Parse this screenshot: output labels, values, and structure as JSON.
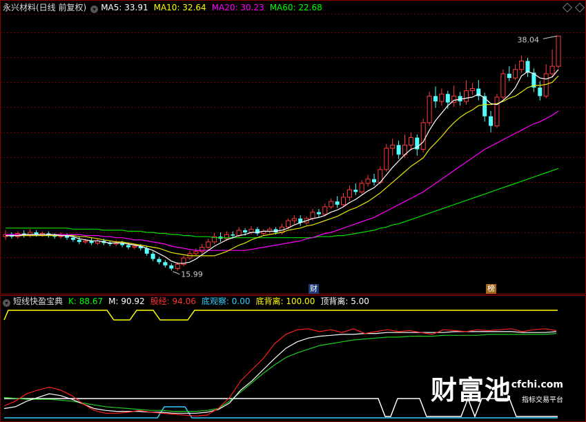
{
  "stock_title": "永兴材料(日线 前复权)",
  "ma_legend": [
    {
      "label": "MA5: 33.91",
      "color": "#ffffff"
    },
    {
      "label": "MA10: 32.64",
      "color": "#ffff00"
    },
    {
      "label": "MA20: 30.23",
      "color": "#ff00ff"
    },
    {
      "label": "MA60: 22.68",
      "color": "#00ff00"
    }
  ],
  "high_label": "38.04",
  "low_label": "15.99",
  "tags": {
    "cai": "财",
    "bang": "榜"
  },
  "indicator": {
    "name": "短线快盈宝典",
    "items": [
      {
        "label": "K: 88.67",
        "color": "#00ff00"
      },
      {
        "label": "M: 90.92",
        "color": "#ffffff"
      },
      {
        "label": "股经: 94.06",
        "color": "#ff3333"
      },
      {
        "label": "底观察: 0.00",
        "color": "#33ccff"
      },
      {
        "label": "底背离: 100.00",
        "color": "#ffff00"
      },
      {
        "label": "顶背离: 5.00",
        "color": "#ffffff"
      }
    ]
  },
  "watermark": {
    "main": "财富池",
    "url": "cfchi.com",
    "sub": "指标交易平台"
  },
  "chart_data": {
    "type": "candlestick",
    "ylim": [
      15,
      40
    ],
    "candles": [
      [
        19.2,
        19.4,
        18.9,
        19.8
      ],
      [
        19.4,
        19.2,
        19.0,
        19.6
      ],
      [
        19.2,
        19.5,
        19.0,
        19.7
      ],
      [
        19.5,
        19.3,
        19.1,
        19.8
      ],
      [
        19.3,
        19.6,
        19.1,
        19.9
      ],
      [
        19.6,
        19.4,
        19.2,
        19.8
      ],
      [
        19.4,
        19.5,
        19.2,
        19.7
      ],
      [
        19.5,
        19.3,
        19.1,
        19.7
      ],
      [
        19.3,
        19.2,
        19.0,
        19.5
      ],
      [
        19.2,
        19.3,
        19.0,
        19.6
      ],
      [
        19.3,
        19.1,
        18.9,
        19.5
      ],
      [
        19.1,
        18.9,
        18.7,
        19.3
      ],
      [
        18.9,
        18.7,
        18.5,
        19.2
      ],
      [
        18.7,
        18.8,
        18.5,
        19.0
      ],
      [
        18.8,
        18.6,
        18.4,
        19.1
      ],
      [
        18.6,
        18.8,
        18.4,
        19.0
      ],
      [
        18.8,
        18.6,
        18.4,
        19.0
      ],
      [
        18.6,
        18.5,
        18.3,
        18.8
      ],
      [
        18.5,
        18.6,
        18.3,
        18.9
      ],
      [
        18.6,
        18.4,
        18.2,
        18.8
      ],
      [
        18.4,
        18.2,
        18.0,
        18.6
      ],
      [
        18.2,
        18.3,
        18.0,
        18.5
      ],
      [
        18.3,
        18.1,
        17.9,
        18.5
      ],
      [
        18.1,
        17.6,
        17.4,
        18.3
      ],
      [
        17.6,
        17.1,
        16.9,
        17.8
      ],
      [
        17.1,
        16.8,
        16.6,
        17.3
      ],
      [
        16.8,
        16.5,
        16.3,
        17.0
      ],
      [
        16.5,
        16.2,
        15.99,
        16.7
      ],
      [
        16.2,
        16.6,
        16.0,
        16.8
      ],
      [
        16.6,
        17.2,
        16.4,
        17.4
      ],
      [
        17.2,
        17.6,
        17.0,
        17.9
      ],
      [
        17.6,
        17.8,
        17.4,
        18.1
      ],
      [
        17.8,
        18.2,
        17.6,
        18.5
      ],
      [
        18.2,
        18.7,
        18.0,
        19.0
      ],
      [
        18.7,
        19.2,
        18.5,
        19.5
      ],
      [
        19.2,
        19.0,
        18.7,
        19.6
      ],
      [
        19.0,
        19.4,
        18.8,
        19.7
      ],
      [
        19.4,
        19.3,
        19.0,
        19.7
      ],
      [
        19.3,
        19.8,
        19.1,
        20.1
      ],
      [
        19.8,
        19.6,
        19.3,
        20.0
      ],
      [
        19.6,
        19.9,
        19.4,
        20.2
      ],
      [
        19.9,
        19.5,
        19.3,
        20.1
      ],
      [
        19.5,
        19.7,
        19.3,
        19.9
      ],
      [
        19.7,
        19.9,
        19.5,
        20.1
      ],
      [
        19.9,
        19.6,
        19.4,
        20.1
      ],
      [
        19.6,
        20.1,
        19.4,
        20.4
      ],
      [
        20.1,
        20.7,
        19.9,
        20.9
      ],
      [
        20.7,
        20.9,
        20.4,
        21.2
      ],
      [
        20.9,
        20.5,
        20.2,
        21.2
      ],
      [
        20.5,
        20.9,
        20.3,
        21.1
      ],
      [
        20.9,
        21.5,
        20.7,
        21.8
      ],
      [
        21.5,
        21.3,
        21.0,
        21.8
      ],
      [
        21.3,
        22.0,
        21.1,
        22.3
      ],
      [
        22.0,
        22.5,
        21.8,
        22.8
      ],
      [
        22.5,
        22.2,
        21.9,
        23.0
      ],
      [
        22.2,
        22.9,
        22.0,
        23.3
      ],
      [
        22.9,
        23.6,
        22.6,
        24.0
      ],
      [
        23.6,
        23.4,
        23.1,
        24.2
      ],
      [
        23.4,
        24.2,
        23.2,
        24.5
      ],
      [
        24.2,
        24.6,
        23.9,
        25.0
      ],
      [
        24.6,
        24.3,
        24.0,
        25.1
      ],
      [
        24.3,
        25.5,
        24.1,
        25.8
      ],
      [
        25.5,
        27.5,
        25.3,
        27.9
      ],
      [
        27.5,
        27.8,
        26.8,
        28.4
      ],
      [
        27.8,
        26.9,
        26.5,
        28.2
      ],
      [
        26.9,
        27.8,
        26.6,
        28.8
      ],
      [
        27.8,
        28.5,
        27.3,
        29.0
      ],
      [
        28.5,
        27.4,
        26.8,
        28.8
      ],
      [
        27.4,
        29.9,
        27.1,
        30.3
      ],
      [
        29.9,
        32.4,
        29.6,
        32.8
      ],
      [
        32.4,
        31.9,
        31.3,
        33.3
      ],
      [
        31.9,
        32.6,
        31.5,
        33.1
      ],
      [
        32.6,
        31.8,
        31.2,
        32.9
      ],
      [
        31.8,
        32.4,
        31.4,
        33.4
      ],
      [
        32.4,
        31.9,
        31.5,
        32.8
      ],
      [
        31.9,
        32.9,
        31.6,
        33.9
      ],
      [
        32.9,
        33.1,
        32.5,
        33.6
      ],
      [
        33.1,
        32.4,
        32.0,
        33.9
      ],
      [
        32.4,
        30.5,
        30.0,
        32.7
      ],
      [
        30.5,
        29.6,
        29.0,
        31.0
      ],
      [
        29.6,
        32.3,
        29.4,
        32.6
      ],
      [
        32.3,
        34.5,
        32.1,
        34.9
      ],
      [
        34.5,
        34.1,
        33.8,
        35.2
      ],
      [
        34.1,
        34.9,
        33.9,
        35.4
      ],
      [
        34.9,
        35.7,
        34.6,
        36.2
      ],
      [
        35.7,
        34.6,
        34.2,
        36.0
      ],
      [
        34.6,
        33.2,
        32.8,
        35.0
      ],
      [
        33.2,
        32.4,
        32.0,
        33.8
      ],
      [
        32.4,
        34.5,
        32.2,
        35.4
      ],
      [
        34.5,
        35.2,
        34.2,
        36.8
      ],
      [
        35.2,
        38.04,
        35.0,
        38.04
      ]
    ],
    "ma5": [
      19.3,
      19.3,
      19.3,
      19.4,
      19.4,
      19.4,
      19.4,
      19.4,
      19.4,
      19.3,
      19.3,
      19.2,
      19.0,
      18.9,
      18.8,
      18.8,
      18.7,
      18.6,
      18.6,
      18.6,
      18.5,
      18.4,
      18.3,
      18.1,
      17.9,
      17.6,
      17.3,
      16.9,
      16.7,
      16.7,
      16.8,
      17.1,
      17.5,
      17.9,
      18.3,
      18.6,
      18.9,
      19.1,
      19.3,
      19.4,
      19.6,
      19.6,
      19.7,
      19.7,
      19.7,
      19.8,
      20.0,
      20.3,
      20.5,
      20.7,
      20.9,
      21.0,
      21.2,
      21.5,
      21.7,
      22.0,
      22.4,
      22.7,
      23.1,
      23.5,
      23.8,
      24.3,
      25.0,
      25.7,
      26.3,
      26.9,
      27.4,
      27.6,
      28.1,
      29.2,
      30.1,
      30.8,
      31.5,
      32.0,
      32.1,
      32.2,
      32.3,
      32.6,
      32.2,
      31.7,
      31.6,
      32.0,
      32.5,
      33.2,
      34.3,
      34.7,
      34.5,
      34.1,
      34.0,
      34.2,
      34.9
    ],
    "ma10": [
      19.3,
      19.3,
      19.3,
      19.3,
      19.3,
      19.3,
      19.3,
      19.3,
      19.3,
      19.3,
      19.3,
      19.3,
      19.2,
      19.2,
      19.1,
      19.0,
      18.9,
      18.8,
      18.7,
      18.7,
      18.6,
      18.5,
      18.4,
      18.3,
      18.2,
      18.1,
      17.9,
      17.7,
      17.6,
      17.5,
      17.4,
      17.4,
      17.4,
      17.4,
      17.4,
      17.6,
      17.8,
      18.1,
      18.4,
      18.6,
      18.9,
      19.1,
      19.3,
      19.4,
      19.5,
      19.6,
      19.8,
      19.9,
      20.0,
      20.2,
      20.3,
      20.5,
      20.7,
      20.9,
      21.1,
      21.4,
      21.7,
      21.9,
      22.2,
      22.5,
      22.9,
      23.3,
      23.8,
      24.3,
      24.8,
      25.3,
      25.8,
      26.2,
      26.6,
      27.4,
      28.0,
      28.6,
      29.3,
      29.9,
      30.4,
      30.8,
      31.1,
      31.5,
      31.6,
      31.6,
      31.7,
      31.9,
      32.2,
      32.4,
      32.8,
      33.2,
      33.4,
      33.4,
      33.5,
      33.7,
      34.3
    ],
    "ma20": [
      19.4,
      19.4,
      19.4,
      19.4,
      19.4,
      19.4,
      19.4,
      19.4,
      19.4,
      19.4,
      19.4,
      19.4,
      19.4,
      19.3,
      19.3,
      19.3,
      19.2,
      19.2,
      19.1,
      19.1,
      19.0,
      18.9,
      18.9,
      18.8,
      18.7,
      18.6,
      18.5,
      18.3,
      18.2,
      18.1,
      18.0,
      17.9,
      17.9,
      17.9,
      17.9,
      17.9,
      17.9,
      17.9,
      17.9,
      17.9,
      18.0,
      18.1,
      18.2,
      18.3,
      18.4,
      18.5,
      18.6,
      18.7,
      18.8,
      19.0,
      19.1,
      19.3,
      19.5,
      19.6,
      19.8,
      20.0,
      20.2,
      20.4,
      20.6,
      20.8,
      21.0,
      21.3,
      21.6,
      21.9,
      22.2,
      22.5,
      22.8,
      23.1,
      23.4,
      23.8,
      24.2,
      24.6,
      25.0,
      25.4,
      25.8,
      26.2,
      26.6,
      27.0,
      27.4,
      27.7,
      28.0,
      28.3,
      28.6,
      28.9,
      29.2,
      29.5,
      29.8,
      30.0,
      30.3,
      30.6,
      31.0
    ],
    "ma60": [
      20.0,
      20.0,
      20.0,
      20.0,
      20.0,
      20.0,
      20.0,
      20.0,
      20.0,
      20.0,
      20.0,
      19.9,
      19.9,
      19.9,
      19.9,
      19.9,
      19.8,
      19.8,
      19.8,
      19.8,
      19.7,
      19.7,
      19.7,
      19.6,
      19.6,
      19.5,
      19.5,
      19.4,
      19.4,
      19.3,
      19.3,
      19.2,
      19.2,
      19.2,
      19.1,
      19.1,
      19.1,
      19.1,
      19.1,
      19.1,
      19.1,
      19.1,
      19.1,
      19.1,
      19.1,
      19.1,
      19.1,
      19.1,
      19.1,
      19.1,
      19.1,
      19.2,
      19.2,
      19.2,
      19.3,
      19.3,
      19.4,
      19.5,
      19.6,
      19.7,
      19.8,
      20.0,
      20.1,
      20.3,
      20.4,
      20.6,
      20.8,
      21.0,
      21.2,
      21.4,
      21.6,
      21.8,
      22.0,
      22.2,
      22.4,
      22.6,
      22.8,
      23.0,
      23.2,
      23.4,
      23.6,
      23.8,
      24.0,
      24.2,
      24.4,
      24.6,
      24.8,
      25.0,
      25.2,
      25.4,
      25.6
    ],
    "ind": {
      "ylim": [
        0,
        110
      ],
      "red": [
        13,
        18,
        26,
        30,
        33,
        30,
        24,
        15,
        8,
        5,
        5,
        6,
        8,
        6,
        5,
        4,
        3,
        2,
        3,
        10,
        22,
        40,
        52,
        64,
        80,
        90,
        95,
        96,
        93,
        95,
        92,
        96,
        91,
        93,
        95,
        93,
        94,
        92,
        90,
        95,
        94,
        93,
        95,
        94,
        95,
        96,
        93,
        95,
        96,
        94
      ],
      "white": [
        10,
        12,
        18,
        22,
        26,
        24,
        20,
        15,
        10,
        8,
        7,
        7,
        7,
        6,
        6,
        5,
        5,
        5,
        6,
        9,
        16,
        30,
        40,
        52,
        64,
        75,
        82,
        86,
        88,
        89,
        90,
        90,
        91,
        91,
        92,
        92,
        92,
        92,
        92,
        92,
        93,
        93,
        93,
        93,
        93,
        93,
        92,
        92,
        92,
        93
      ],
      "green": [
        22,
        21,
        20,
        20,
        20,
        19,
        18,
        16,
        14,
        12,
        11,
        10,
        9,
        8,
        8,
        7,
        7,
        7,
        8,
        10,
        18,
        28,
        38,
        48,
        57,
        65,
        70,
        74,
        78,
        80,
        82,
        84,
        85,
        86,
        87,
        87,
        88,
        88,
        88,
        89,
        89,
        89,
        89,
        90,
        90,
        90,
        90,
        90,
        90,
        91
      ]
    }
  }
}
